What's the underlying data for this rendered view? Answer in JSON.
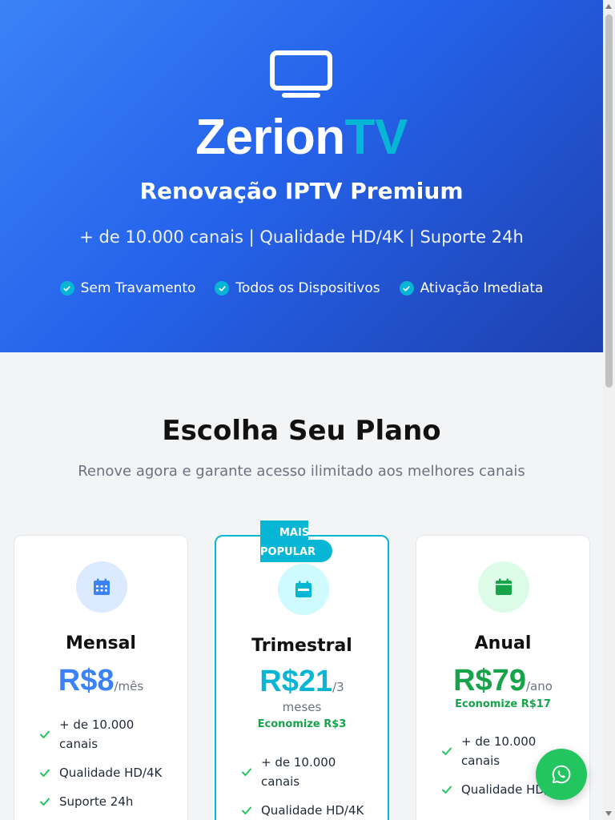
{
  "hero": {
    "brand_main": "Zerion",
    "brand_accent": "TV",
    "subtitle": "Renovação IPTV Premium",
    "tagline": "+ de 10.000 canais | Qualidade HD/4K | Suporte 24h",
    "features": [
      "Sem Travamento",
      "Todos os Dispositivos",
      "Ativação Imediata"
    ],
    "icon": "tv-icon"
  },
  "plans_section": {
    "title": "Escolha Seu Plano",
    "subtitle": "Renove agora e garante acesso ilimitado aos melhores canais"
  },
  "plans": [
    {
      "name": "Mensal",
      "price": "R$8",
      "period": "/mês",
      "savings": "",
      "icon": "calendar-days-icon",
      "color": "#3b82f6",
      "icon_bg": "#dbeafe",
      "features": [
        "+ de 10.000 canais",
        "Qualidade HD/4K",
        "Suporte 24h"
      ]
    },
    {
      "name": "Trimestral",
      "price": "R$21",
      "period": "/3",
      "period_line2": "meses",
      "savings": "Economize R$3",
      "badge_line1": "MAIS",
      "badge_line2": "POPULAR",
      "icon": "calendar-week-icon",
      "color": "#06b6d4",
      "icon_bg": "#cffafe",
      "features": [
        "+ de 10.000 canais",
        "Qualidade HD/4K"
      ]
    },
    {
      "name": "Anual",
      "price": "R$79",
      "period": "/ano",
      "savings": "Economize R$17",
      "icon": "calendar-icon",
      "color": "#16a34a",
      "icon_bg": "#dcfce7",
      "features": [
        "+ de 10.000 canais",
        "Qualidade HD/4K"
      ]
    }
  ],
  "colors": {
    "check": "#22c55e",
    "accent": "#06b6d4",
    "whatsapp": "#22c55e"
  },
  "floating": {
    "icon": "whatsapp-icon"
  }
}
